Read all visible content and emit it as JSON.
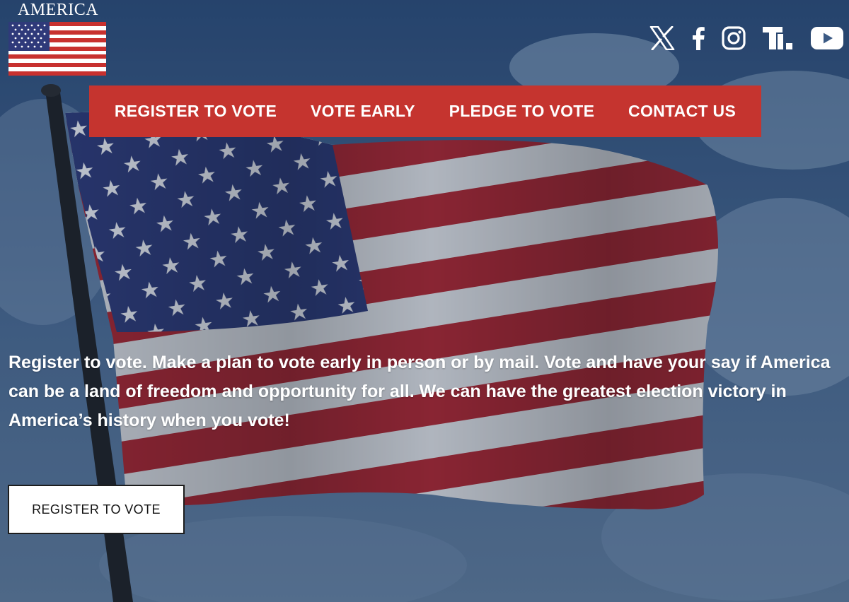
{
  "brand": {
    "name": "AMERICA"
  },
  "social": [
    {
      "label": "X",
      "icon": "x-icon"
    },
    {
      "label": "Facebook",
      "icon": "facebook-icon"
    },
    {
      "label": "Instagram",
      "icon": "instagram-icon"
    },
    {
      "label": "Truth Social",
      "icon": "truth-social-icon"
    },
    {
      "label": "YouTube",
      "icon": "youtube-icon"
    }
  ],
  "nav": {
    "items": [
      {
        "label": "REGISTER TO VOTE"
      },
      {
        "label": "VOTE EARLY"
      },
      {
        "label": "PLEDGE TO VOTE"
      },
      {
        "label": "CONTACT US"
      }
    ]
  },
  "hero": {
    "text": "Register to vote. Make a plan to vote early in person or by mail. Vote and have your say if America can be a land of freedom and opportunity for all. We can have the greatest election victory in America’s history when you vote!",
    "cta_label": "REGISTER TO VOTE"
  },
  "colors": {
    "nav_background": "#c5342f",
    "text": "#ffffff",
    "button_background": "#ffffff",
    "button_text": "#111111"
  }
}
